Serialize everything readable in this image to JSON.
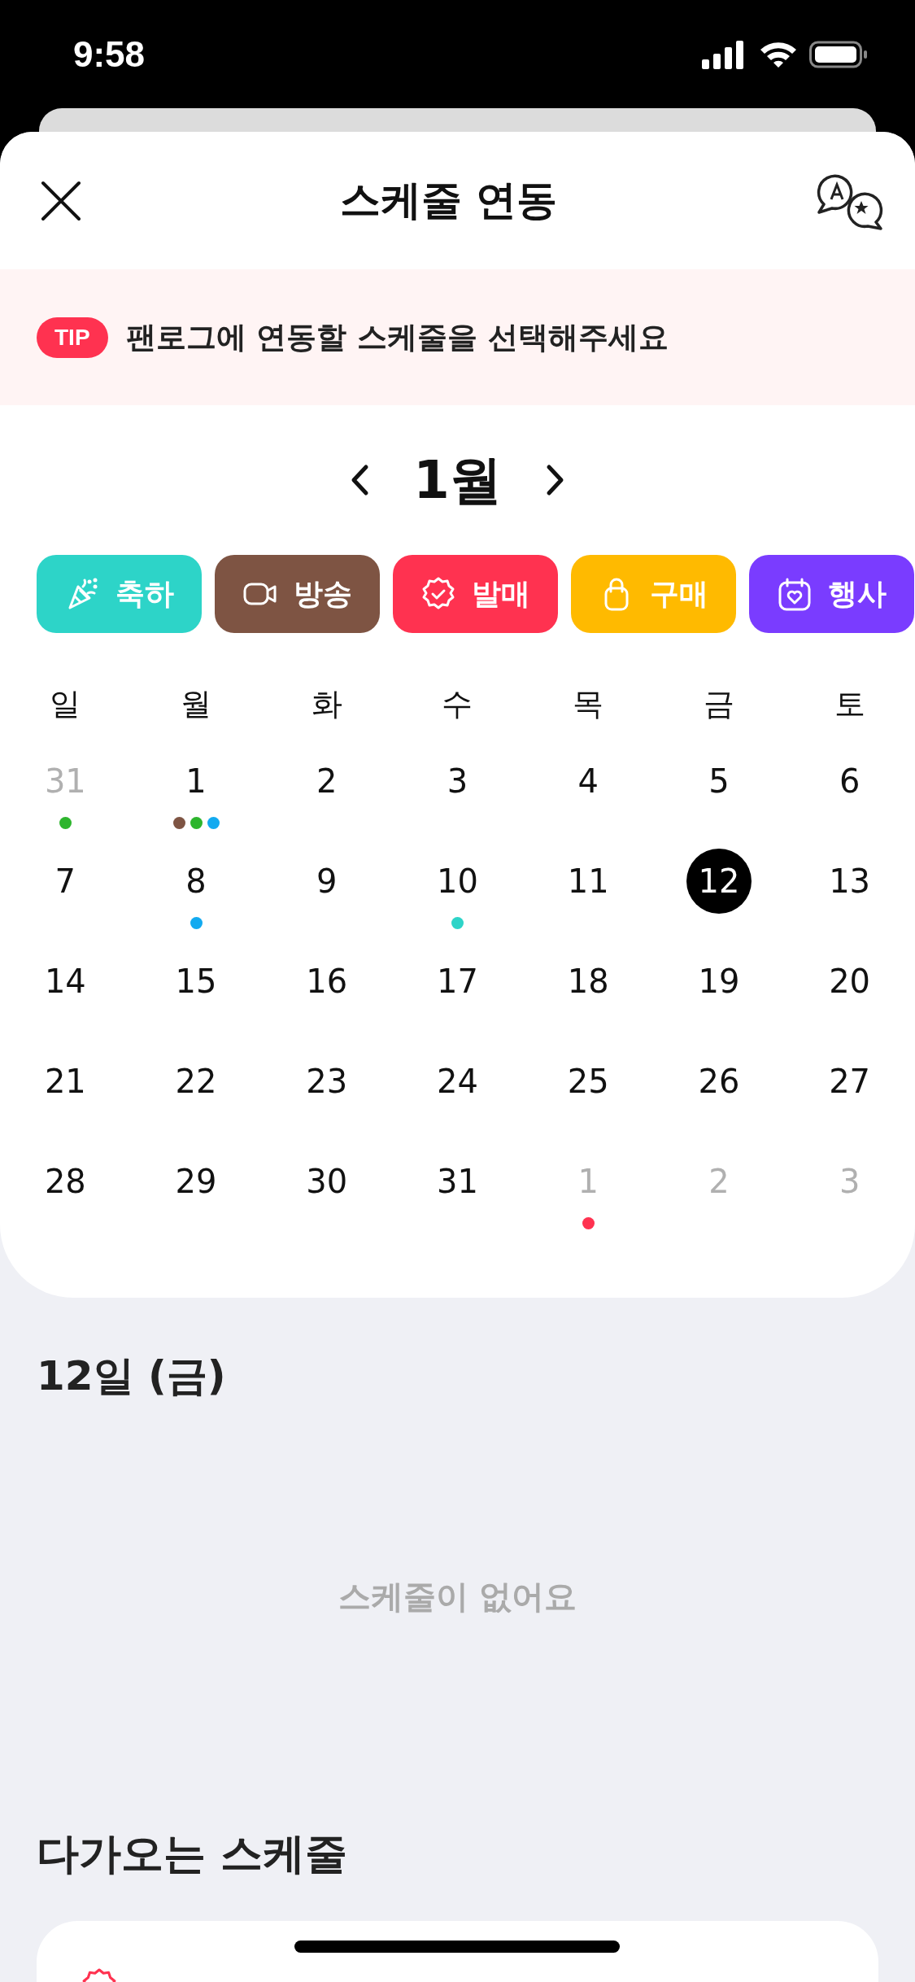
{
  "status_bar": {
    "time": "9:58"
  },
  "header": {
    "title": "스케줄 연동"
  },
  "tip": {
    "badge": "TIP",
    "text": "팬로그에 연동할 스케줄을 선택해주세요"
  },
  "calendar": {
    "month": "1월",
    "categories": [
      {
        "label": "축하",
        "color": "#2dd4c8"
      },
      {
        "label": "방송",
        "color": "#7e5443"
      },
      {
        "label": "발매",
        "color": "#ff3250"
      },
      {
        "label": "구매",
        "color": "#ffba00"
      },
      {
        "label": "행사",
        "color": "#7a3cff"
      }
    ],
    "weekdays": [
      "일",
      "월",
      "화",
      "수",
      "목",
      "금",
      "토"
    ],
    "weeks": [
      [
        {
          "day": "31",
          "muted": true,
          "selected": false,
          "dots": [
            {
              "color": "#2db52d"
            }
          ]
        },
        {
          "day": "1",
          "muted": false,
          "selected": false,
          "dots": [
            {
              "color": "#7e5443"
            },
            {
              "color": "#2db52d"
            },
            {
              "color": "#12aaf0"
            }
          ]
        },
        {
          "day": "2",
          "muted": false,
          "selected": false
        },
        {
          "day": "3",
          "muted": false,
          "selected": false
        },
        {
          "day": "4",
          "muted": false,
          "selected": false
        },
        {
          "day": "5",
          "muted": false,
          "selected": false
        },
        {
          "day": "6",
          "muted": false,
          "selected": false
        }
      ],
      [
        {
          "day": "7",
          "muted": false,
          "selected": false
        },
        {
          "day": "8",
          "muted": false,
          "selected": false,
          "dots": [
            {
              "color": "#12aaf0"
            }
          ]
        },
        {
          "day": "9",
          "muted": false,
          "selected": false
        },
        {
          "day": "10",
          "muted": false,
          "selected": false,
          "dots": [
            {
              "color": "#2dd4c8"
            }
          ]
        },
        {
          "day": "11",
          "muted": false,
          "selected": false
        },
        {
          "day": "12",
          "muted": false,
          "selected": true
        },
        {
          "day": "13",
          "muted": false,
          "selected": false
        }
      ],
      [
        {
          "day": "14",
          "muted": false,
          "selected": false
        },
        {
          "day": "15",
          "muted": false,
          "selected": false
        },
        {
          "day": "16",
          "muted": false,
          "selected": false
        },
        {
          "day": "17",
          "muted": false,
          "selected": false
        },
        {
          "day": "18",
          "muted": false,
          "selected": false
        },
        {
          "day": "19",
          "muted": false,
          "selected": false
        },
        {
          "day": "20",
          "muted": false,
          "selected": false
        }
      ],
      [
        {
          "day": "21",
          "muted": false,
          "selected": false
        },
        {
          "day": "22",
          "muted": false,
          "selected": false
        },
        {
          "day": "23",
          "muted": false,
          "selected": false
        },
        {
          "day": "24",
          "muted": false,
          "selected": false
        },
        {
          "day": "25",
          "muted": false,
          "selected": false
        },
        {
          "day": "26",
          "muted": false,
          "selected": false
        },
        {
          "day": "27",
          "muted": false,
          "selected": false
        }
      ],
      [
        {
          "day": "28",
          "muted": false,
          "selected": false
        },
        {
          "day": "29",
          "muted": false,
          "selected": false
        },
        {
          "day": "30",
          "muted": false,
          "selected": false
        },
        {
          "day": "31",
          "muted": false,
          "selected": false
        },
        {
          "day": "1",
          "muted": true,
          "selected": false,
          "dots": [
            {
              "color": "#ff3250"
            }
          ]
        },
        {
          "day": "2",
          "muted": true,
          "selected": false
        },
        {
          "day": "3",
          "muted": true,
          "selected": false
        }
      ]
    ]
  },
  "selected_day": {
    "title": "12일 (금)",
    "empty_text": "스케줄이 없어요"
  },
  "upcoming": {
    "title": "다가오는 스케줄"
  }
}
